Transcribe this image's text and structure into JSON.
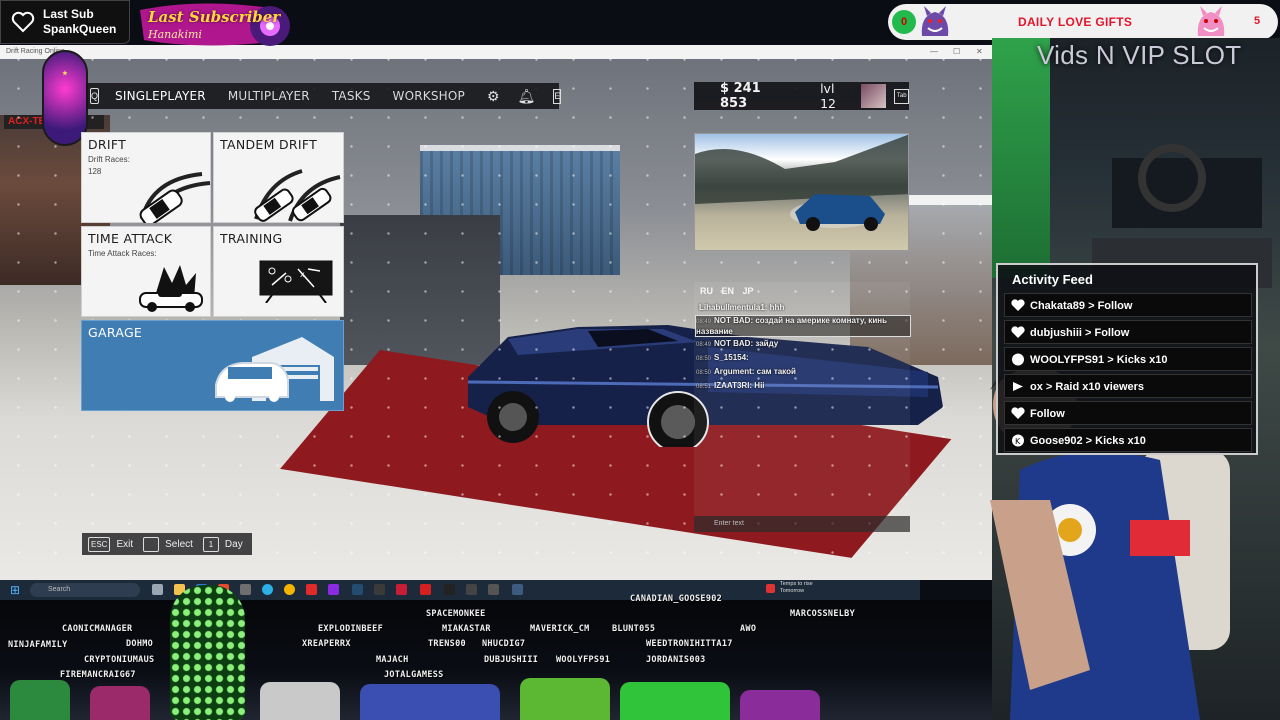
{
  "overlay": {
    "last_sub": {
      "label": "Last Sub",
      "name": "SpankQueen"
    },
    "last_subscriber_banner": {
      "title": "Last Subscriber",
      "name": "Hanakimi"
    },
    "daily_gifts": {
      "left_count": "0",
      "title": "DAILY LOVE GIFTS",
      "right_count": "5"
    },
    "vip_title": "Vids N VIP SLOT",
    "activity_feed": {
      "title": "Activity Feed",
      "items": [
        {
          "icon": "heart-icon",
          "text": "Chakata89 > Follow"
        },
        {
          "icon": "heart-icon",
          "text": "dubjushiii > Follow"
        },
        {
          "icon": "kick-icon",
          "text": "WOOLYFPS91 > Kicks x10"
        },
        {
          "icon": "raid-icon",
          "text": "ox > Raid x10 viewers"
        },
        {
          "icon": "heart-icon",
          "text": "Follow"
        },
        {
          "icon": "kick-icon",
          "text": "Goose902 > Kicks x10"
        }
      ]
    },
    "usernames": [
      "CANADIAN_GOOSE902",
      "SPACEMONKEE",
      "CAONICMANAGER",
      "EXPLODINBEEF",
      "MIAKASTAR",
      "MAVERICK_CM",
      "BLUNT055",
      "AWO",
      "MARCOSSNELBY",
      "DOHMO",
      "XREAPERRX",
      "TRENS00",
      "NHUCDIG7",
      "WEEDTRONIHITTA17",
      "NINJAFAMILY",
      "CRYPTONIUMAUS",
      "MAJACH",
      "DUBJUSHIII",
      "WOOLYFPS91",
      "JORDANIS003",
      "FIREMANCRAIG67",
      "JOTALGAMESS"
    ]
  },
  "game": {
    "window_title": "Drift Racing Online",
    "nav": {
      "search_key": "Q",
      "items": [
        "SINGLEPLAYER",
        "MULTIPLAYER",
        "TASKS",
        "WORKSHOP"
      ],
      "end_key": "E"
    },
    "tiles": {
      "drift": {
        "title": "DRIFT",
        "sub1": "Drift Races:",
        "sub2": "128"
      },
      "tandem": {
        "title": "TANDEM DRIFT"
      },
      "time_attack": {
        "title": "TIME ATTACK",
        "sub1": "Time Attack Races:"
      },
      "training": {
        "title": "TRAINING"
      },
      "garage": {
        "title": "GARAGE"
      }
    },
    "bottom_bar": [
      {
        "key": "ESC",
        "label": "Exit"
      },
      {
        "key": "",
        "label": "Select"
      },
      {
        "key": "1",
        "label": "Day"
      }
    ],
    "money": "$ 241 853",
    "level": "lvl 12",
    "tab_key": "Tab",
    "chat": {
      "languages": "RU EN JP",
      "messages": [
        {
          "time": "",
          "text": "Lihabullmentula1: hhh",
          "highlight": false
        },
        {
          "time": "08:49",
          "text": "NOT BAD: создай на америке комнату, кинь название",
          "highlight": true
        },
        {
          "time": "08:49",
          "text": "NOT BAD: зайду",
          "highlight": false
        },
        {
          "time": "08:50",
          "text": "S_15154:",
          "highlight": false
        },
        {
          "time": "08:50",
          "text": "Argument: сам такой",
          "highlight": false
        },
        {
          "time": "08:51",
          "text": "IZAAT3RI: Hii",
          "highlight": false
        }
      ],
      "input_placeholder": "Enter text"
    }
  },
  "taskbar": {
    "search_placeholder": "Search",
    "weather_line1": "Temps to rise",
    "weather_line2": "Tomorrow"
  },
  "colors": {
    "garage_tile": "#3f7db3",
    "daily_gifts_red": "#e4142b",
    "feed_bg": "#0e1014",
    "carpet": "#8e1a1f"
  }
}
